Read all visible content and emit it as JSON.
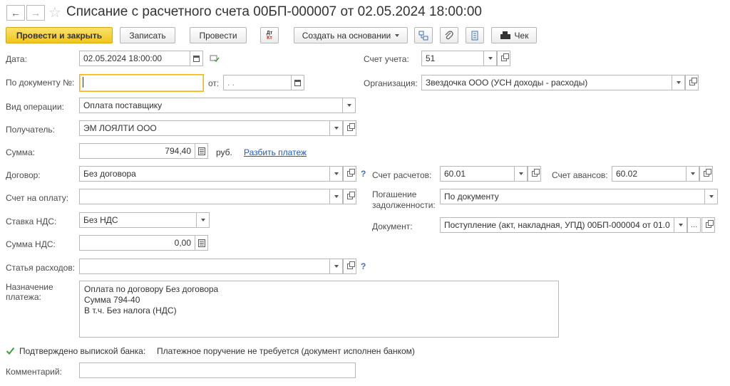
{
  "header": {
    "title": "Списание с расчетного счета 00БП-000007 от 02.05.2024 18:00:00"
  },
  "toolbar": {
    "post_close": "Провести и закрыть",
    "save": "Записать",
    "post": "Провести",
    "dtkt_top": "Дт",
    "dtkt_bottom": "Кт",
    "create_based": "Создать на основании",
    "check": "Чек"
  },
  "form": {
    "date_label": "Дата:",
    "date_value": "02.05.2024 18:00:00",
    "account_label": "Счет учета:",
    "account_value": "51",
    "docnum_label": "По документу №:",
    "docnum_value": "",
    "from_label": "от:",
    "from_value": " .  .",
    "org_label": "Организация:",
    "org_value": "Звездочка ООО (УСН доходы - расходы)",
    "operation_label": "Вид операции:",
    "operation_value": "Оплата поставщику",
    "recipient_label": "Получатель:",
    "recipient_value": "ЭМ ЛОЯЛТИ ООО",
    "sum_label": "Сумма:",
    "sum_value": "794,40",
    "currency": "руб.",
    "split_link": "Разбить платеж",
    "contract_label": "Договор:",
    "contract_value": "Без договора",
    "settle_label": "Счет расчетов:",
    "settle_value": "60.01",
    "advance_label": "Счет авансов:",
    "advance_value": "60.02",
    "invoice_label": "Счет на оплату:",
    "invoice_value": "",
    "repay_label_1": "Погашение",
    "repay_label_2": "задолженности:",
    "repay_value": "По документу",
    "vat_rate_label": "Ставка НДС:",
    "vat_rate_value": "Без НДС",
    "document_label": "Документ:",
    "document_value": "Поступление (акт, накладная, УПД) 00БП-000004 от 01.0",
    "vat_sum_label": "Сумма НДС:",
    "vat_sum_value": "0,00",
    "expense_label": "Статья расходов:",
    "expense_value": "",
    "purpose_label_1": "Назначение",
    "purpose_label_2": "платежа:",
    "purpose_line1": "Оплата по договору Без договора",
    "purpose_line2": "Сумма 794-40",
    "purpose_line3": "В т.ч. Без налога (НДС)",
    "confirmed_label": "Подтверждено выпиской банка:",
    "confirmed_note": "Платежное поручение не требуется (документ исполнен банком)",
    "comment_label": "Комментарий:",
    "comment_value": "",
    "qmark": "?",
    "ellipsis": "..."
  },
  "colors": {
    "primary_button": "#f2c51b",
    "link": "#1f5bb8",
    "focus_border": "#f2b61c",
    "check_green": "#3aa03a"
  }
}
